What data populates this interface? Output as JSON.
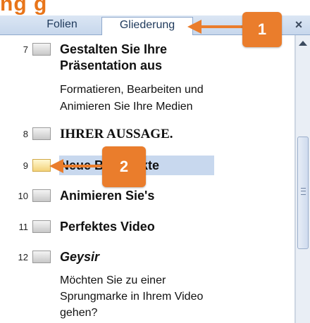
{
  "heading": {
    "text": "ng                                    g"
  },
  "tabs": [
    {
      "label": "Folien"
    },
    {
      "label": "Gliederung"
    }
  ],
  "close_label": "×",
  "slides": [
    {
      "number": "7",
      "title_line1": "Gestalten Sie Ihre",
      "title_line2": "Präsentation aus",
      "body_line1": "Formatieren, Bearbeiten und",
      "body_line2": "Animieren Sie Ihre Medien"
    },
    {
      "number": "8",
      "title": "IHRER  AUSSAGE."
    },
    {
      "number": "9",
      "title": "Neue Bildeffekte"
    },
    {
      "number": "10",
      "title": "Animieren Sie's"
    },
    {
      "number": "11",
      "title": "Perfektes Video"
    },
    {
      "number": "12",
      "title": "Geysir",
      "body_line1": "Möchten  Sie zu einer",
      "body_line2": "Sprungmarke in Ihrem Video",
      "body_line3": "gehen?"
    }
  ],
  "annotations": {
    "callout_1": "1",
    "callout_2": "2",
    "color": "#ea7d2c"
  },
  "colors": {
    "accent": "#ea7d2c",
    "tab_text": "#1e395b",
    "selection": "#c8d8ee",
    "tabbar_bg": "#d3e0f1"
  },
  "icons": {
    "close": "close-icon",
    "scroll_up": "scroll-up-icon",
    "slide_thumbnail": "slide-thumbnail-icon"
  }
}
